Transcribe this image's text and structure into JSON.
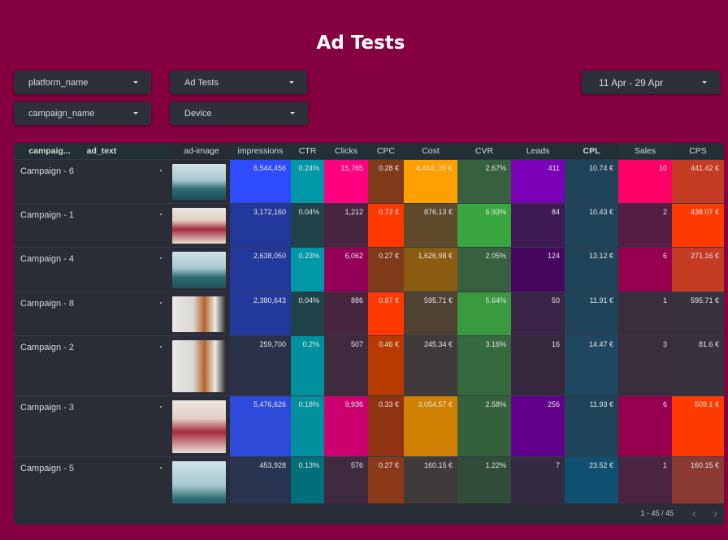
{
  "title": "Ad Tests",
  "filters": {
    "platform_name": "platform_name",
    "ad_tests": "Ad Tests",
    "campaign_name": "campaign_name",
    "device": "Device",
    "date_range": "11 Apr - 29 Apr"
  },
  "table": {
    "headers": [
      "campaig...",
      "ad_text",
      "ad-image",
      "impressions",
      "CTR",
      "Clicks",
      "CPC",
      "Cost",
      "CVR",
      "Leads",
      "CPL",
      "Sales",
      "CPS"
    ],
    "rows": [
      {
        "campaign": "Campaign - 6",
        "impressions": "6,544,456",
        "ctr": "0.24%",
        "clicks": "15,765",
        "cpc": "0.28 €",
        "cost": "4,414, 20 €",
        "cvr": "2.67%",
        "leads": "411",
        "cpl": "10.74 €",
        "sales": "10",
        "cps": "441.42 €",
        "image": "man-on-sofa"
      },
      {
        "campaign": "Campaign - 1",
        "impressions": "3,172,160",
        "ctr": "0.04%",
        "clicks": "1,212",
        "cpc": "0.72 €",
        "cost": "876.13 €",
        "cvr": "6.93%",
        "leads": "84",
        "cpl": "10.43 €",
        "sales": "2",
        "cps": "438.07 €",
        "image": "woman-at-desk"
      },
      {
        "campaign": "Campaign - 4",
        "impressions": "2,638,050",
        "ctr": "0.23%",
        "clicks": "6,062",
        "cpc": "0.27 €",
        "cost": "1,626.98 €",
        "cvr": "2.05%",
        "leads": "124",
        "cpl": "13.12 €",
        "sales": "6",
        "cps": "271.16 €",
        "image": "man-on-sofa"
      },
      {
        "campaign": "Campaign - 8",
        "impressions": "2,380,643",
        "ctr": "0.04%",
        "clicks": "886",
        "cpc": "0.67 €",
        "cost": "595.71 €",
        "cvr": "5.64%",
        "leads": "50",
        "cpl": "11.91 €",
        "sales": "1",
        "cps": "595.71 €",
        "image": "man-at-cafe"
      },
      {
        "campaign": "Campaign - 2",
        "impressions": "259,700",
        "ctr": "0.2%",
        "clicks": "507",
        "cpc": "0.46 €",
        "cost": "245.34 €",
        "cvr": "3.16%",
        "leads": "16",
        "cpl": "14.47 €",
        "sales": "3",
        "cps": "81.6 €",
        "image": "man-at-cafe"
      },
      {
        "campaign": "Campaign - 3",
        "impressions": "5,476,626",
        "ctr": "0.18%",
        "clicks": "9,936",
        "cpc": "0.33 €",
        "cost": "3,054.57 €",
        "cvr": "2.58%",
        "leads": "256",
        "cpl": "11.93 €",
        "sales": "6",
        "cps": "509.1 €",
        "image": "woman-at-desk"
      },
      {
        "campaign": "Campaign - 5",
        "impressions": "453,928",
        "ctr": "0.13%",
        "clicks": "576",
        "cpc": "0.27 €",
        "cost": "160.15 €",
        "cvr": "1.22%",
        "leads": "7",
        "cpl": "23.52 €",
        "sales": "1",
        "cps": "160.15 €",
        "image": "man-on-sofa"
      }
    ],
    "cell_colors": [
      [
        "#2f4bff",
        "#0097a7",
        "#ff0080",
        "#7f3a1a",
        "#ffa000",
        "#37613e",
        "#7b00b8",
        "#1f4358",
        "#ff0066",
        "#c53a22"
      ],
      [
        "#22389a",
        "#1f4349",
        "#472540",
        "#ff3800",
        "#5f4a2c",
        "#3aa640",
        "#3e1a52",
        "#1f4358",
        "#561d44",
        "#ff3a00"
      ],
      [
        "#22389a",
        "#0097a7",
        "#940058",
        "#7f3a1a",
        "#8a5c12",
        "#37603e",
        "#48075f",
        "#1f4358",
        "#96004f",
        "#c53a22"
      ],
      [
        "#22389a",
        "#1f4349",
        "#472540",
        "#ff3800",
        "#4f4232",
        "#3a9a40",
        "#3a2548",
        "#1f4358",
        "#3b2c3e",
        "#38323c"
      ],
      [
        "#2b3248",
        "#00909e",
        "#3f2a40",
        "#b73a00",
        "#403b3a",
        "#346a3e",
        "#37283e",
        "#1f4760",
        "#3b2c3e",
        "#38323c"
      ],
      [
        "#2d4ad8",
        "#00909e",
        "#cc006e",
        "#8f3312",
        "#d08000",
        "#34613c",
        "#610088",
        "#1f4358",
        "#96004f",
        "#ff3a00"
      ],
      [
        "#283450",
        "#006f7a",
        "#3f2a40",
        "#8a3a18",
        "#403b3a",
        "#324c3a",
        "#342a42",
        "#0f5070",
        "#4a2440",
        "#8a3a30"
      ]
    ],
    "pagination": "1 - 45 / 45"
  }
}
